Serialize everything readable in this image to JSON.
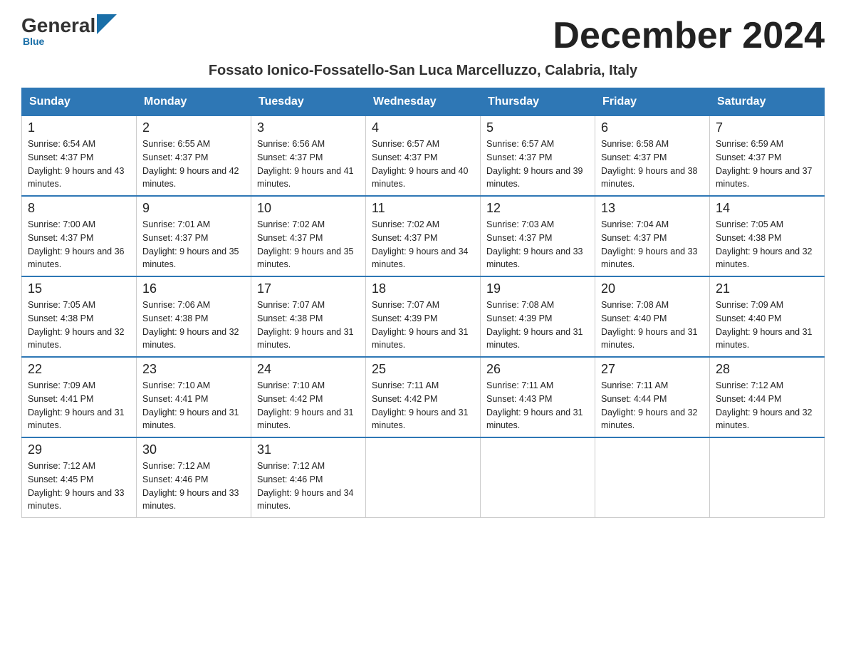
{
  "header": {
    "title": "December 2024",
    "location": "Fossato Ionico-Fossatello-San Luca Marcelluzzo, Calabria, Italy"
  },
  "logo": {
    "general": "General",
    "blue": "Blue"
  },
  "days_of_week": [
    "Sunday",
    "Monday",
    "Tuesday",
    "Wednesday",
    "Thursday",
    "Friday",
    "Saturday"
  ],
  "weeks": [
    [
      {
        "day": 1,
        "sunrise": "6:54 AM",
        "sunset": "4:37 PM",
        "daylight": "9 hours and 43 minutes."
      },
      {
        "day": 2,
        "sunrise": "6:55 AM",
        "sunset": "4:37 PM",
        "daylight": "9 hours and 42 minutes."
      },
      {
        "day": 3,
        "sunrise": "6:56 AM",
        "sunset": "4:37 PM",
        "daylight": "9 hours and 41 minutes."
      },
      {
        "day": 4,
        "sunrise": "6:57 AM",
        "sunset": "4:37 PM",
        "daylight": "9 hours and 40 minutes."
      },
      {
        "day": 5,
        "sunrise": "6:57 AM",
        "sunset": "4:37 PM",
        "daylight": "9 hours and 39 minutes."
      },
      {
        "day": 6,
        "sunrise": "6:58 AM",
        "sunset": "4:37 PM",
        "daylight": "9 hours and 38 minutes."
      },
      {
        "day": 7,
        "sunrise": "6:59 AM",
        "sunset": "4:37 PM",
        "daylight": "9 hours and 37 minutes."
      }
    ],
    [
      {
        "day": 8,
        "sunrise": "7:00 AM",
        "sunset": "4:37 PM",
        "daylight": "9 hours and 36 minutes."
      },
      {
        "day": 9,
        "sunrise": "7:01 AM",
        "sunset": "4:37 PM",
        "daylight": "9 hours and 35 minutes."
      },
      {
        "day": 10,
        "sunrise": "7:02 AM",
        "sunset": "4:37 PM",
        "daylight": "9 hours and 35 minutes."
      },
      {
        "day": 11,
        "sunrise": "7:02 AM",
        "sunset": "4:37 PM",
        "daylight": "9 hours and 34 minutes."
      },
      {
        "day": 12,
        "sunrise": "7:03 AM",
        "sunset": "4:37 PM",
        "daylight": "9 hours and 33 minutes."
      },
      {
        "day": 13,
        "sunrise": "7:04 AM",
        "sunset": "4:37 PM",
        "daylight": "9 hours and 33 minutes."
      },
      {
        "day": 14,
        "sunrise": "7:05 AM",
        "sunset": "4:38 PM",
        "daylight": "9 hours and 32 minutes."
      }
    ],
    [
      {
        "day": 15,
        "sunrise": "7:05 AM",
        "sunset": "4:38 PM",
        "daylight": "9 hours and 32 minutes."
      },
      {
        "day": 16,
        "sunrise": "7:06 AM",
        "sunset": "4:38 PM",
        "daylight": "9 hours and 32 minutes."
      },
      {
        "day": 17,
        "sunrise": "7:07 AM",
        "sunset": "4:38 PM",
        "daylight": "9 hours and 31 minutes."
      },
      {
        "day": 18,
        "sunrise": "7:07 AM",
        "sunset": "4:39 PM",
        "daylight": "9 hours and 31 minutes."
      },
      {
        "day": 19,
        "sunrise": "7:08 AM",
        "sunset": "4:39 PM",
        "daylight": "9 hours and 31 minutes."
      },
      {
        "day": 20,
        "sunrise": "7:08 AM",
        "sunset": "4:40 PM",
        "daylight": "9 hours and 31 minutes."
      },
      {
        "day": 21,
        "sunrise": "7:09 AM",
        "sunset": "4:40 PM",
        "daylight": "9 hours and 31 minutes."
      }
    ],
    [
      {
        "day": 22,
        "sunrise": "7:09 AM",
        "sunset": "4:41 PM",
        "daylight": "9 hours and 31 minutes."
      },
      {
        "day": 23,
        "sunrise": "7:10 AM",
        "sunset": "4:41 PM",
        "daylight": "9 hours and 31 minutes."
      },
      {
        "day": 24,
        "sunrise": "7:10 AM",
        "sunset": "4:42 PM",
        "daylight": "9 hours and 31 minutes."
      },
      {
        "day": 25,
        "sunrise": "7:11 AM",
        "sunset": "4:42 PM",
        "daylight": "9 hours and 31 minutes."
      },
      {
        "day": 26,
        "sunrise": "7:11 AM",
        "sunset": "4:43 PM",
        "daylight": "9 hours and 31 minutes."
      },
      {
        "day": 27,
        "sunrise": "7:11 AM",
        "sunset": "4:44 PM",
        "daylight": "9 hours and 32 minutes."
      },
      {
        "day": 28,
        "sunrise": "7:12 AM",
        "sunset": "4:44 PM",
        "daylight": "9 hours and 32 minutes."
      }
    ],
    [
      {
        "day": 29,
        "sunrise": "7:12 AM",
        "sunset": "4:45 PM",
        "daylight": "9 hours and 33 minutes."
      },
      {
        "day": 30,
        "sunrise": "7:12 AM",
        "sunset": "4:46 PM",
        "daylight": "9 hours and 33 minutes."
      },
      {
        "day": 31,
        "sunrise": "7:12 AM",
        "sunset": "4:46 PM",
        "daylight": "9 hours and 34 minutes."
      },
      null,
      null,
      null,
      null
    ]
  ]
}
